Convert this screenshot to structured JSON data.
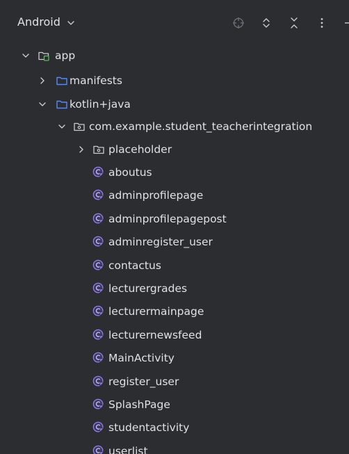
{
  "header": {
    "view_label": "Android",
    "view_chevron_icon": "chevron-down-icon",
    "tools": [
      "locate-icon",
      "expand-all-icon",
      "collapse-all-icon",
      "more-options-icon",
      "minimize-icon"
    ]
  },
  "colors": {
    "background": "#2b2d30",
    "text": "#dfe1e5",
    "folder_blue": "#548af7",
    "module_green": "#5fb865",
    "class_purple": "#9a7cf5",
    "muted_icon": "#6f737a"
  },
  "tree": {
    "app": {
      "label": "app",
      "expanded": true
    },
    "manifests": {
      "label": "manifests",
      "expanded": false
    },
    "kotlin_java": {
      "label": "kotlin+java",
      "expanded": true
    },
    "package": {
      "label": "com.example.student_teacherintegration",
      "expanded": true
    },
    "placeholder": {
      "label": "placeholder",
      "expanded": false
    },
    "classes": [
      "aboutus",
      "adminprofilepage",
      "adminprofilepagepost",
      "adminregister_user",
      "contactus",
      "lecturergrades",
      "lecturermainpage",
      "lecturernewsfeed",
      "MainActivity",
      "register_user",
      "SplashPage",
      "studentactivity",
      "userlist"
    ]
  }
}
